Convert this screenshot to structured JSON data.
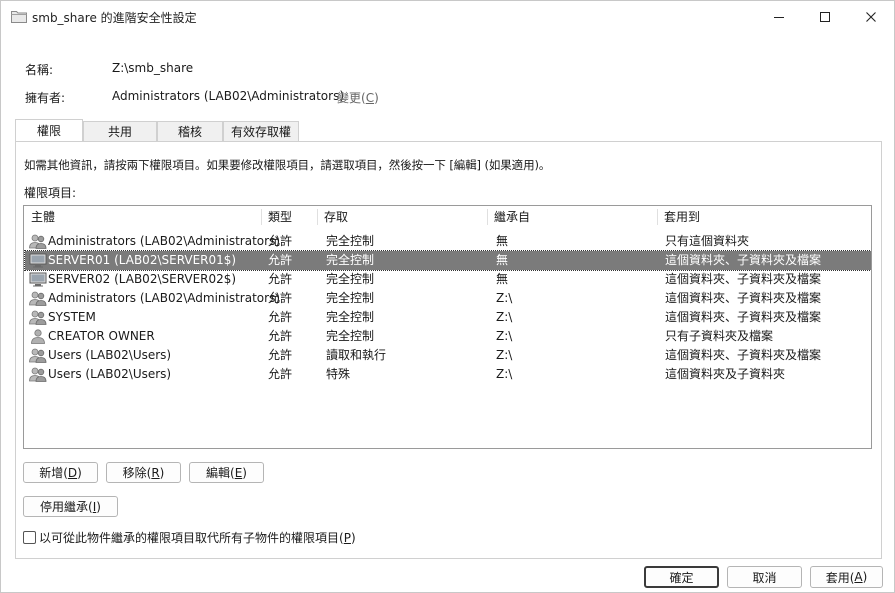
{
  "window": {
    "title": "smb_share 的進階安全性設定"
  },
  "info": {
    "name_label": "名稱:",
    "name_value": "Z:\\smb_share",
    "owner_label": "擁有者:",
    "owner_value": "Administrators (LAB02\\Administrators)",
    "change_label": "變更(",
    "change_key": "C",
    "change_end": ")"
  },
  "tabs": [
    {
      "label": "權限",
      "active": true
    },
    {
      "label": "共用",
      "active": false
    },
    {
      "label": "稽核",
      "active": false
    },
    {
      "label": "有效存取權",
      "active": false
    }
  ],
  "permissions": {
    "description": "如需其他資訊，請按兩下權限項目。如果要修改權限項目，請選取項目，然後按一下 [編輯] (如果適用)。",
    "entries_label": "權限項目:",
    "columns": [
      "主體",
      "類型",
      "存取",
      "繼承自",
      "套用到"
    ],
    "rows": [
      {
        "principal": "Administrators (LAB02\\Administrators)",
        "type": "允許",
        "access": "完全控制",
        "inherited": "無",
        "applies": "只有這個資料夾",
        "icon": "users-icon",
        "selected": false
      },
      {
        "principal": "SERVER01 (LAB02\\SERVER01$)",
        "type": "允許",
        "access": "完全控制",
        "inherited": "無",
        "applies": "這個資料夾、子資料夾及檔案",
        "icon": "computer-icon",
        "selected": true
      },
      {
        "principal": "SERVER02 (LAB02\\SERVER02$)",
        "type": "允許",
        "access": "完全控制",
        "inherited": "無",
        "applies": "這個資料夾、子資料夾及檔案",
        "icon": "computer-icon",
        "selected": false
      },
      {
        "principal": "Administrators (LAB02\\Administrators)",
        "type": "允許",
        "access": "完全控制",
        "inherited": "Z:\\",
        "applies": "這個資料夾、子資料夾及檔案",
        "icon": "users-icon",
        "selected": false
      },
      {
        "principal": "SYSTEM",
        "type": "允許",
        "access": "完全控制",
        "inherited": "Z:\\",
        "applies": "這個資料夾、子資料夾及檔案",
        "icon": "users-icon",
        "selected": false
      },
      {
        "principal": "CREATOR OWNER",
        "type": "允許",
        "access": "完全控制",
        "inherited": "Z:\\",
        "applies": "只有子資料夾及檔案",
        "icon": "user-icon",
        "selected": false
      },
      {
        "principal": "Users (LAB02\\Users)",
        "type": "允許",
        "access": "讀取和執行",
        "inherited": "Z:\\",
        "applies": "這個資料夾、子資料夾及檔案",
        "icon": "users-icon",
        "selected": false
      },
      {
        "principal": "Users (LAB02\\Users)",
        "type": "允許",
        "access": "特殊",
        "inherited": "Z:\\",
        "applies": "這個資料夾及子資料夾",
        "icon": "users-icon",
        "selected": false
      }
    ]
  },
  "buttons": {
    "add": {
      "text": "新增(",
      "key": "D",
      "end": ")"
    },
    "remove": {
      "text": "移除(",
      "key": "R",
      "end": ")"
    },
    "edit": {
      "text": "編輯(",
      "key": "E",
      "end": ")"
    },
    "disable_inheritance": {
      "text": "停用繼承(",
      "key": "I",
      "end": ")"
    },
    "ok": "確定",
    "cancel": "取消",
    "apply": {
      "text": "套用(",
      "key": "A",
      "end": ")"
    }
  },
  "replace_checkbox": {
    "label": "以可從此物件繼承的權限項目取代所有子物件的權限項目(",
    "key": "P",
    "end": ")",
    "checked": false
  },
  "colors": {
    "selection": "#7b7b7b",
    "border": "#9a9a9a",
    "link": "#666666"
  }
}
